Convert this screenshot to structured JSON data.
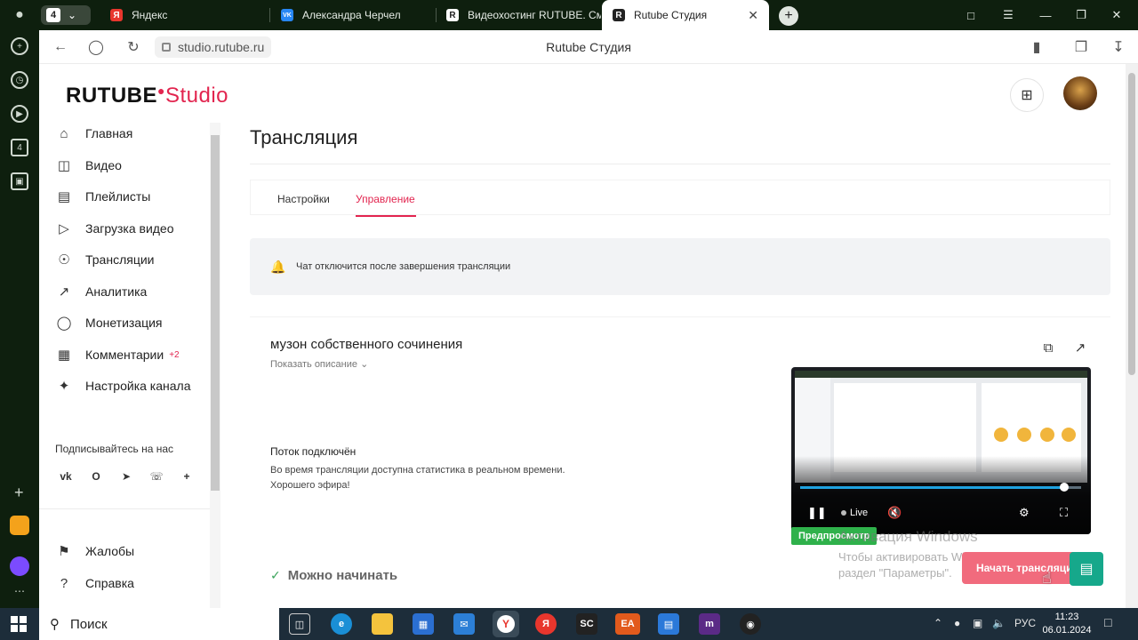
{
  "browser": {
    "tab_counter": "4",
    "tabs": [
      {
        "label": "Яндекс",
        "fav": "Я",
        "color": "#e8362d"
      },
      {
        "label": "Александра Черчел",
        "fav": "VK",
        "color": "#2787f5"
      },
      {
        "label": "Видеохостинг RUTUBE. Смо",
        "fav": "R",
        "color": "#222222"
      },
      {
        "label": "Rutube Студия",
        "fav": "R",
        "color": "#222222"
      }
    ],
    "url": "studio.rutube.ru",
    "page_title": "Rutube Студия"
  },
  "logo": {
    "rutube": "RUTUBE",
    "studio": "Studio"
  },
  "sidebar": {
    "items": [
      {
        "label": "Главная",
        "icon": "home-icon"
      },
      {
        "label": "Видео",
        "icon": "video-icon"
      },
      {
        "label": "Плейлисты",
        "icon": "playlist-icon"
      },
      {
        "label": "Загрузка видео",
        "icon": "upload-icon"
      },
      {
        "label": "Трансляции",
        "icon": "broadcast-icon"
      },
      {
        "label": "Аналитика",
        "icon": "analytics-icon"
      },
      {
        "label": "Монетизация",
        "icon": "money-icon"
      },
      {
        "label": "Комментарии",
        "icon": "comment-icon",
        "badge": "+2"
      },
      {
        "label": "Настройка канала",
        "icon": "wand-icon"
      }
    ],
    "subscribe_title": "Подписывайтесь на нас",
    "socials": [
      "vk",
      "ok",
      "tg",
      "viber",
      "+"
    ],
    "bottom_items": [
      {
        "label": "Жалобы",
        "icon": "flag-icon"
      },
      {
        "label": "Справка",
        "icon": "help-icon"
      }
    ]
  },
  "main": {
    "title": "Трансляция",
    "tabs": [
      {
        "label": "Настройки"
      },
      {
        "label": "Управление",
        "active": true
      }
    ],
    "notice": "Чат отключится после завершения трансляции",
    "stream": {
      "title": "музон собственного сочинения",
      "show_description": "Показать описание",
      "status_title": "Поток подключён",
      "status_line1": "Во время трансляции доступна статистика в реальном времени.",
      "status_line2": "Хорошего эфира!",
      "ready": "Можно начинать",
      "preview_tag": "Предпросмотр",
      "live_label": "Live",
      "progress": 0.94
    },
    "start_button": "Начать трансляцию"
  },
  "watermark": {
    "title": "Активация Windows",
    "line1": "Чтобы активировать Windows, перейдите в",
    "line2": "раздел \"Параметры\"."
  },
  "taskbar": {
    "search": "Поиск",
    "lang": "РУС",
    "time": "11:23",
    "date": "06.01.2024"
  },
  "colors": {
    "accent": "#e2254f",
    "ok": "#2fb14b",
    "chat": "#16a88b"
  }
}
